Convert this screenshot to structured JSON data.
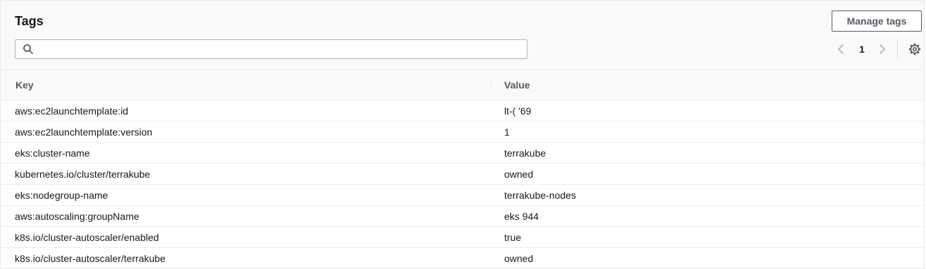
{
  "header": {
    "title": "Tags",
    "manage_button": "Manage tags",
    "search": {
      "value": "",
      "placeholder": ""
    }
  },
  "pagination": {
    "current_page": "1",
    "prev_icon": "chevron-left-icon",
    "next_icon": "chevron-right-icon"
  },
  "icons": {
    "search": "search-icon",
    "settings": "gear-icon"
  },
  "table": {
    "columns": [
      "Key",
      "Value"
    ],
    "rows": [
      {
        "key": "aws:ec2launchtemplate:id",
        "value": "lt-(                      '69"
      },
      {
        "key": "aws:ec2launchtemplate:version",
        "value": "1"
      },
      {
        "key": "eks:cluster-name",
        "value": "terrakube"
      },
      {
        "key": "kubernetes.io/cluster/terrakube",
        "value": "owned"
      },
      {
        "key": "eks:nodegroup-name",
        "value": "terrakube-nodes"
      },
      {
        "key": "aws:autoscaling:groupName",
        "value": "eks                                              944"
      },
      {
        "key": "k8s.io/cluster-autoscaler/enabled",
        "value": "true"
      },
      {
        "key": "k8s.io/cluster-autoscaler/terrakube",
        "value": "owned"
      }
    ]
  },
  "colors": {
    "text": "#16191f",
    "secondary_text": "#545b64",
    "border": "#eaeded",
    "header_bg": "#fafafa"
  }
}
